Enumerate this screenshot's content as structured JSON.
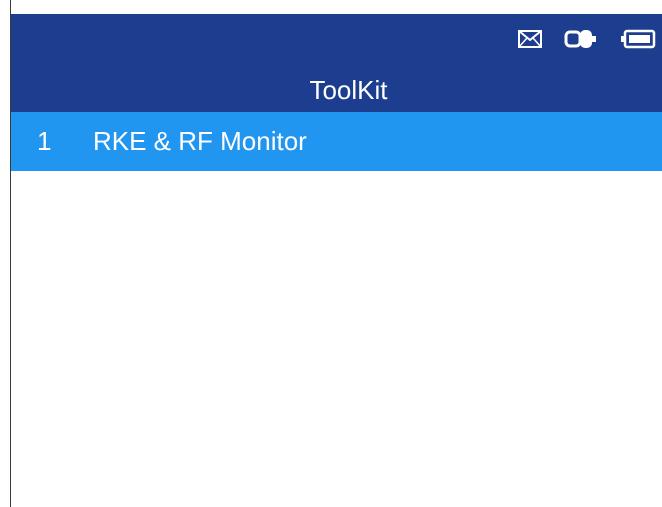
{
  "header": {
    "title": "ToolKit",
    "status_icons": [
      "mail-icon",
      "vehicle-icon",
      "battery-icon"
    ]
  },
  "menu": {
    "items": [
      {
        "number": "1",
        "label": "RKE & RF Monitor",
        "selected": true
      }
    ]
  },
  "colors": {
    "header_bg": "#1d3d8f",
    "selected_bg": "#2196f0",
    "text": "#ffffff",
    "body_bg": "#ffffff"
  }
}
